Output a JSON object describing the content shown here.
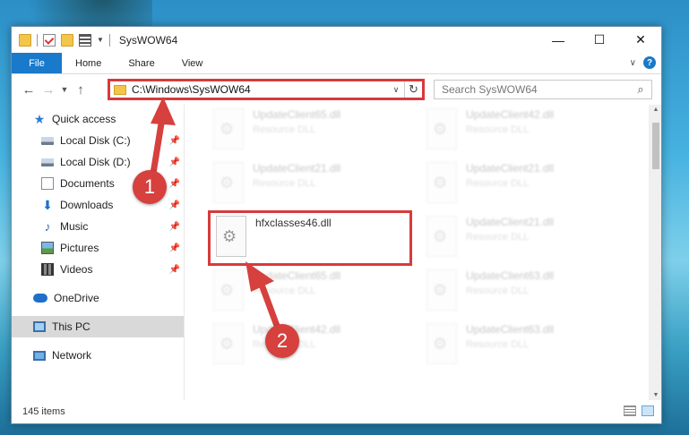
{
  "window": {
    "title": "SysWOW64",
    "caption": {
      "minimize": "—",
      "maximize": "☐",
      "close": "✕"
    }
  },
  "ribbon": {
    "file": "File",
    "tabs": [
      "Home",
      "Share",
      "View"
    ]
  },
  "address": {
    "path": "C:\\Windows\\SysWOW64",
    "search_placeholder": "Search SysWOW64"
  },
  "nav": {
    "quick_access": "Quick access",
    "items": [
      {
        "label": "Local Disk (C:)",
        "icon": "drive-icon"
      },
      {
        "label": "Local Disk (D:)",
        "icon": "drive-icon"
      },
      {
        "label": "Documents",
        "icon": "documents-icon"
      },
      {
        "label": "Downloads",
        "icon": "downloads-icon"
      },
      {
        "label": "Music",
        "icon": "music-icon"
      },
      {
        "label": "Pictures",
        "icon": "pictures-icon"
      },
      {
        "label": "Videos",
        "icon": "videos-icon"
      }
    ],
    "onedrive": "OneDrive",
    "this_pc": "This PC",
    "network": "Network"
  },
  "files": {
    "highlighted": {
      "name": "hfxclasses46.dll"
    },
    "left_column": [
      {
        "name": "UpdateClient65.dll",
        "type": "Resource DLL"
      },
      {
        "name": "UpdateClient21.dll",
        "type": "Resource DLL"
      },
      {
        "name": "UpdateClient65.dll",
        "type": "Resource DLL"
      },
      {
        "name": "UpdateClient42.dll",
        "type": "Resource DLL"
      }
    ],
    "right_column": [
      {
        "name": "UpdateClient42.dll",
        "type": "Resource DLL"
      },
      {
        "name": "UpdateClient21.dll",
        "type": "Resource DLL"
      },
      {
        "name": "UpdateClient21.dll",
        "type": "Resource DLL"
      },
      {
        "name": "UpdateClient63.dll",
        "type": "Resource DLL"
      },
      {
        "name": "UpdateClient63.dll",
        "type": "Resource DLL"
      }
    ]
  },
  "status": {
    "count": "145 items"
  },
  "annotations": {
    "step1": "1",
    "step2": "2"
  },
  "colors": {
    "accent": "#1979ca",
    "highlight": "#d83a3a",
    "badge": "#d6403d"
  }
}
